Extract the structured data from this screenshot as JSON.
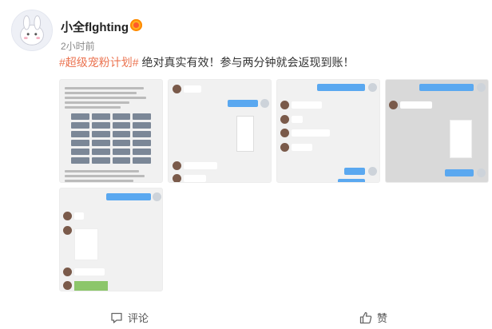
{
  "post": {
    "username": "小全flghting",
    "timestamp": "2小时前",
    "hashtag": "#超级宠粉计划#",
    "text": " 绝对真实有效！参与两分钟就会返现到账！"
  },
  "images": [
    {
      "name": "screenshot-1",
      "type": "document"
    },
    {
      "name": "screenshot-2",
      "type": "chat"
    },
    {
      "name": "screenshot-3",
      "type": "chat"
    },
    {
      "name": "screenshot-4",
      "type": "chat-dark"
    },
    {
      "name": "screenshot-5",
      "type": "chat"
    }
  ],
  "actions": {
    "comment_label": "评论",
    "like_label": "赞"
  },
  "colors": {
    "hashtag": "#eb7350",
    "chat_bubble": "#5aa8f0",
    "badge": "#ffb020"
  }
}
